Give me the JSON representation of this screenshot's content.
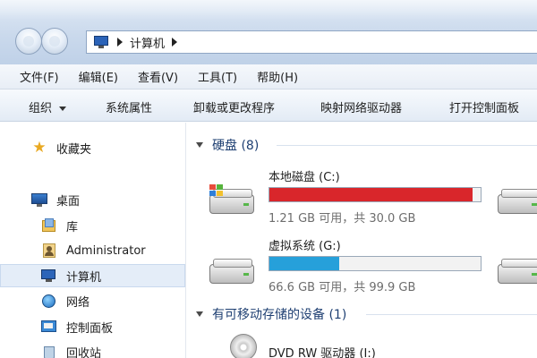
{
  "address": {
    "location_label": "计算机",
    "location_icon": "computer-icon"
  },
  "menubar": [
    {
      "label": "文件(F)"
    },
    {
      "label": "编辑(E)"
    },
    {
      "label": "查看(V)"
    },
    {
      "label": "工具(T)"
    },
    {
      "label": "帮助(H)"
    }
  ],
  "toolbar": {
    "organize_label": "组织",
    "system_props_label": "系统属性",
    "uninstall_label": "卸载或更改程序",
    "map_drive_label": "映射网络驱动器",
    "control_panel_label": "打开控制面板"
  },
  "sidebar": {
    "items": [
      {
        "label": "收藏夹",
        "icon": "star-icon"
      },
      {
        "label": "桌面",
        "icon": "desktop-icon"
      },
      {
        "label": "库",
        "icon": "library-icon"
      },
      {
        "label": "Administrator",
        "icon": "user-folder-icon"
      },
      {
        "label": "计算机",
        "icon": "computer-icon",
        "selected": true
      },
      {
        "label": "网络",
        "icon": "network-icon"
      },
      {
        "label": "控制面板",
        "icon": "control-panel-icon"
      },
      {
        "label": "回收站",
        "icon": "recycle-bin-icon"
      }
    ]
  },
  "main": {
    "hard_disks": {
      "title": "硬盘 (8)",
      "drives": [
        {
          "name": "本地磁盘 (C:)",
          "free_text": "1.21 GB 可用，共 30.0 GB",
          "used_fraction": 0.96,
          "bar_color": "#d9262b"
        },
        {
          "name": "虚拟系统 (G:)",
          "free_text": "66.6 GB 可用，共 99.9 GB",
          "used_fraction": 0.33,
          "bar_color": "#26a0da"
        }
      ]
    },
    "removable": {
      "title": "有可移动存储的设备 (1)",
      "device_label": "DVD RW 驱动器 (I:)"
    }
  }
}
